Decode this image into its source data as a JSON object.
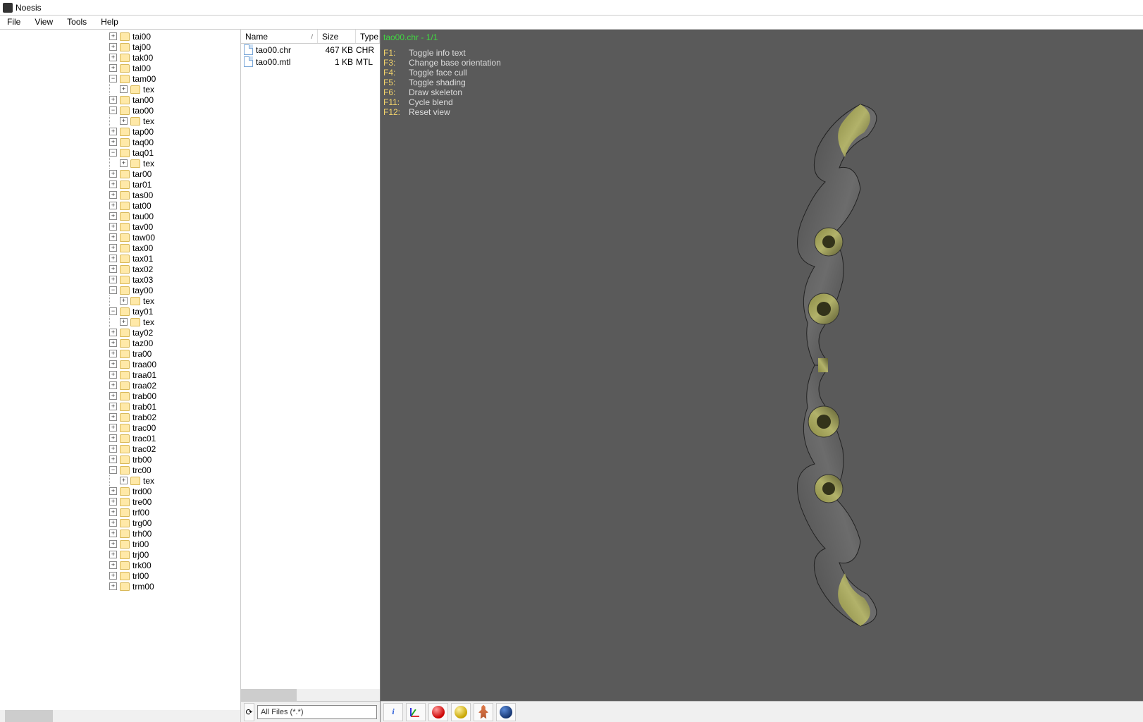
{
  "title": "Noesis",
  "menu": {
    "file": "File",
    "view": "View",
    "tools": "Tools",
    "help": "Help"
  },
  "tree": {
    "items": [
      {
        "d": 0,
        "e": "+",
        "n": "tai00"
      },
      {
        "d": 0,
        "e": "+",
        "n": "taj00"
      },
      {
        "d": 0,
        "e": "+",
        "n": "tak00"
      },
      {
        "d": 0,
        "e": "+",
        "n": "tal00"
      },
      {
        "d": 0,
        "e": "-",
        "n": "tam00"
      },
      {
        "d": 1,
        "e": "+",
        "n": "tex"
      },
      {
        "d": 0,
        "e": "+",
        "n": "tan00"
      },
      {
        "d": 0,
        "e": "-",
        "n": "tao00"
      },
      {
        "d": 1,
        "e": "+",
        "n": "tex"
      },
      {
        "d": 0,
        "e": "+",
        "n": "tap00"
      },
      {
        "d": 0,
        "e": "+",
        "n": "taq00"
      },
      {
        "d": 0,
        "e": "-",
        "n": "taq01"
      },
      {
        "d": 1,
        "e": "+",
        "n": "tex"
      },
      {
        "d": 0,
        "e": "+",
        "n": "tar00"
      },
      {
        "d": 0,
        "e": "+",
        "n": "tar01"
      },
      {
        "d": 0,
        "e": "+",
        "n": "tas00"
      },
      {
        "d": 0,
        "e": "+",
        "n": "tat00"
      },
      {
        "d": 0,
        "e": "+",
        "n": "tau00"
      },
      {
        "d": 0,
        "e": "+",
        "n": "tav00"
      },
      {
        "d": 0,
        "e": "+",
        "n": "taw00"
      },
      {
        "d": 0,
        "e": "+",
        "n": "tax00"
      },
      {
        "d": 0,
        "e": "+",
        "n": "tax01"
      },
      {
        "d": 0,
        "e": "+",
        "n": "tax02"
      },
      {
        "d": 0,
        "e": "+",
        "n": "tax03"
      },
      {
        "d": 0,
        "e": "-",
        "n": "tay00"
      },
      {
        "d": 1,
        "e": "+",
        "n": "tex"
      },
      {
        "d": 0,
        "e": "-",
        "n": "tay01"
      },
      {
        "d": 1,
        "e": "+",
        "n": "tex"
      },
      {
        "d": 0,
        "e": "+",
        "n": "tay02"
      },
      {
        "d": 0,
        "e": "+",
        "n": "taz00"
      },
      {
        "d": 0,
        "e": "+",
        "n": "tra00"
      },
      {
        "d": 0,
        "e": "+",
        "n": "traa00"
      },
      {
        "d": 0,
        "e": "+",
        "n": "traa01"
      },
      {
        "d": 0,
        "e": "+",
        "n": "traa02"
      },
      {
        "d": 0,
        "e": "+",
        "n": "trab00"
      },
      {
        "d": 0,
        "e": "+",
        "n": "trab01"
      },
      {
        "d": 0,
        "e": "+",
        "n": "trab02"
      },
      {
        "d": 0,
        "e": "+",
        "n": "trac00"
      },
      {
        "d": 0,
        "e": "+",
        "n": "trac01"
      },
      {
        "d": 0,
        "e": "+",
        "n": "trac02"
      },
      {
        "d": 0,
        "e": "+",
        "n": "trb00"
      },
      {
        "d": 0,
        "e": "-",
        "n": "trc00"
      },
      {
        "d": 1,
        "e": "+",
        "n": "tex"
      },
      {
        "d": 0,
        "e": "+",
        "n": "trd00"
      },
      {
        "d": 0,
        "e": "+",
        "n": "tre00"
      },
      {
        "d": 0,
        "e": "+",
        "n": "trf00"
      },
      {
        "d": 0,
        "e": "+",
        "n": "trg00"
      },
      {
        "d": 0,
        "e": "+",
        "n": "trh00"
      },
      {
        "d": 0,
        "e": "+",
        "n": "tri00"
      },
      {
        "d": 0,
        "e": "+",
        "n": "trj00"
      },
      {
        "d": 0,
        "e": "+",
        "n": "trk00"
      },
      {
        "d": 0,
        "e": "+",
        "n": "trl00"
      },
      {
        "d": 0,
        "e": "+",
        "n": "trm00"
      }
    ]
  },
  "list": {
    "cols": {
      "name": "Name",
      "size": "Size",
      "type": "Type"
    },
    "sort_indicator": "/",
    "rows": [
      {
        "name": "tao00.chr",
        "size": "467 KB",
        "type": "CHR"
      },
      {
        "name": "tao00.mtl",
        "size": "1 KB",
        "type": "MTL"
      }
    ]
  },
  "viewport": {
    "file_line": "tao00.chr - 1/1",
    "help": [
      {
        "k": "F1:",
        "t": "Toggle info text"
      },
      {
        "k": "F3:",
        "t": "Change base orientation"
      },
      {
        "k": "F4:",
        "t": "Toggle face cull"
      },
      {
        "k": "F5:",
        "t": "Toggle shading"
      },
      {
        "k": "F6:",
        "t": "Draw skeleton"
      },
      {
        "k": "F11:",
        "t": "Cycle blend"
      },
      {
        "k": "F12:",
        "t": "Reset view"
      }
    ]
  },
  "toolbar": {
    "refresh_glyph": "⟳",
    "filter": "All Files (*.*)"
  }
}
